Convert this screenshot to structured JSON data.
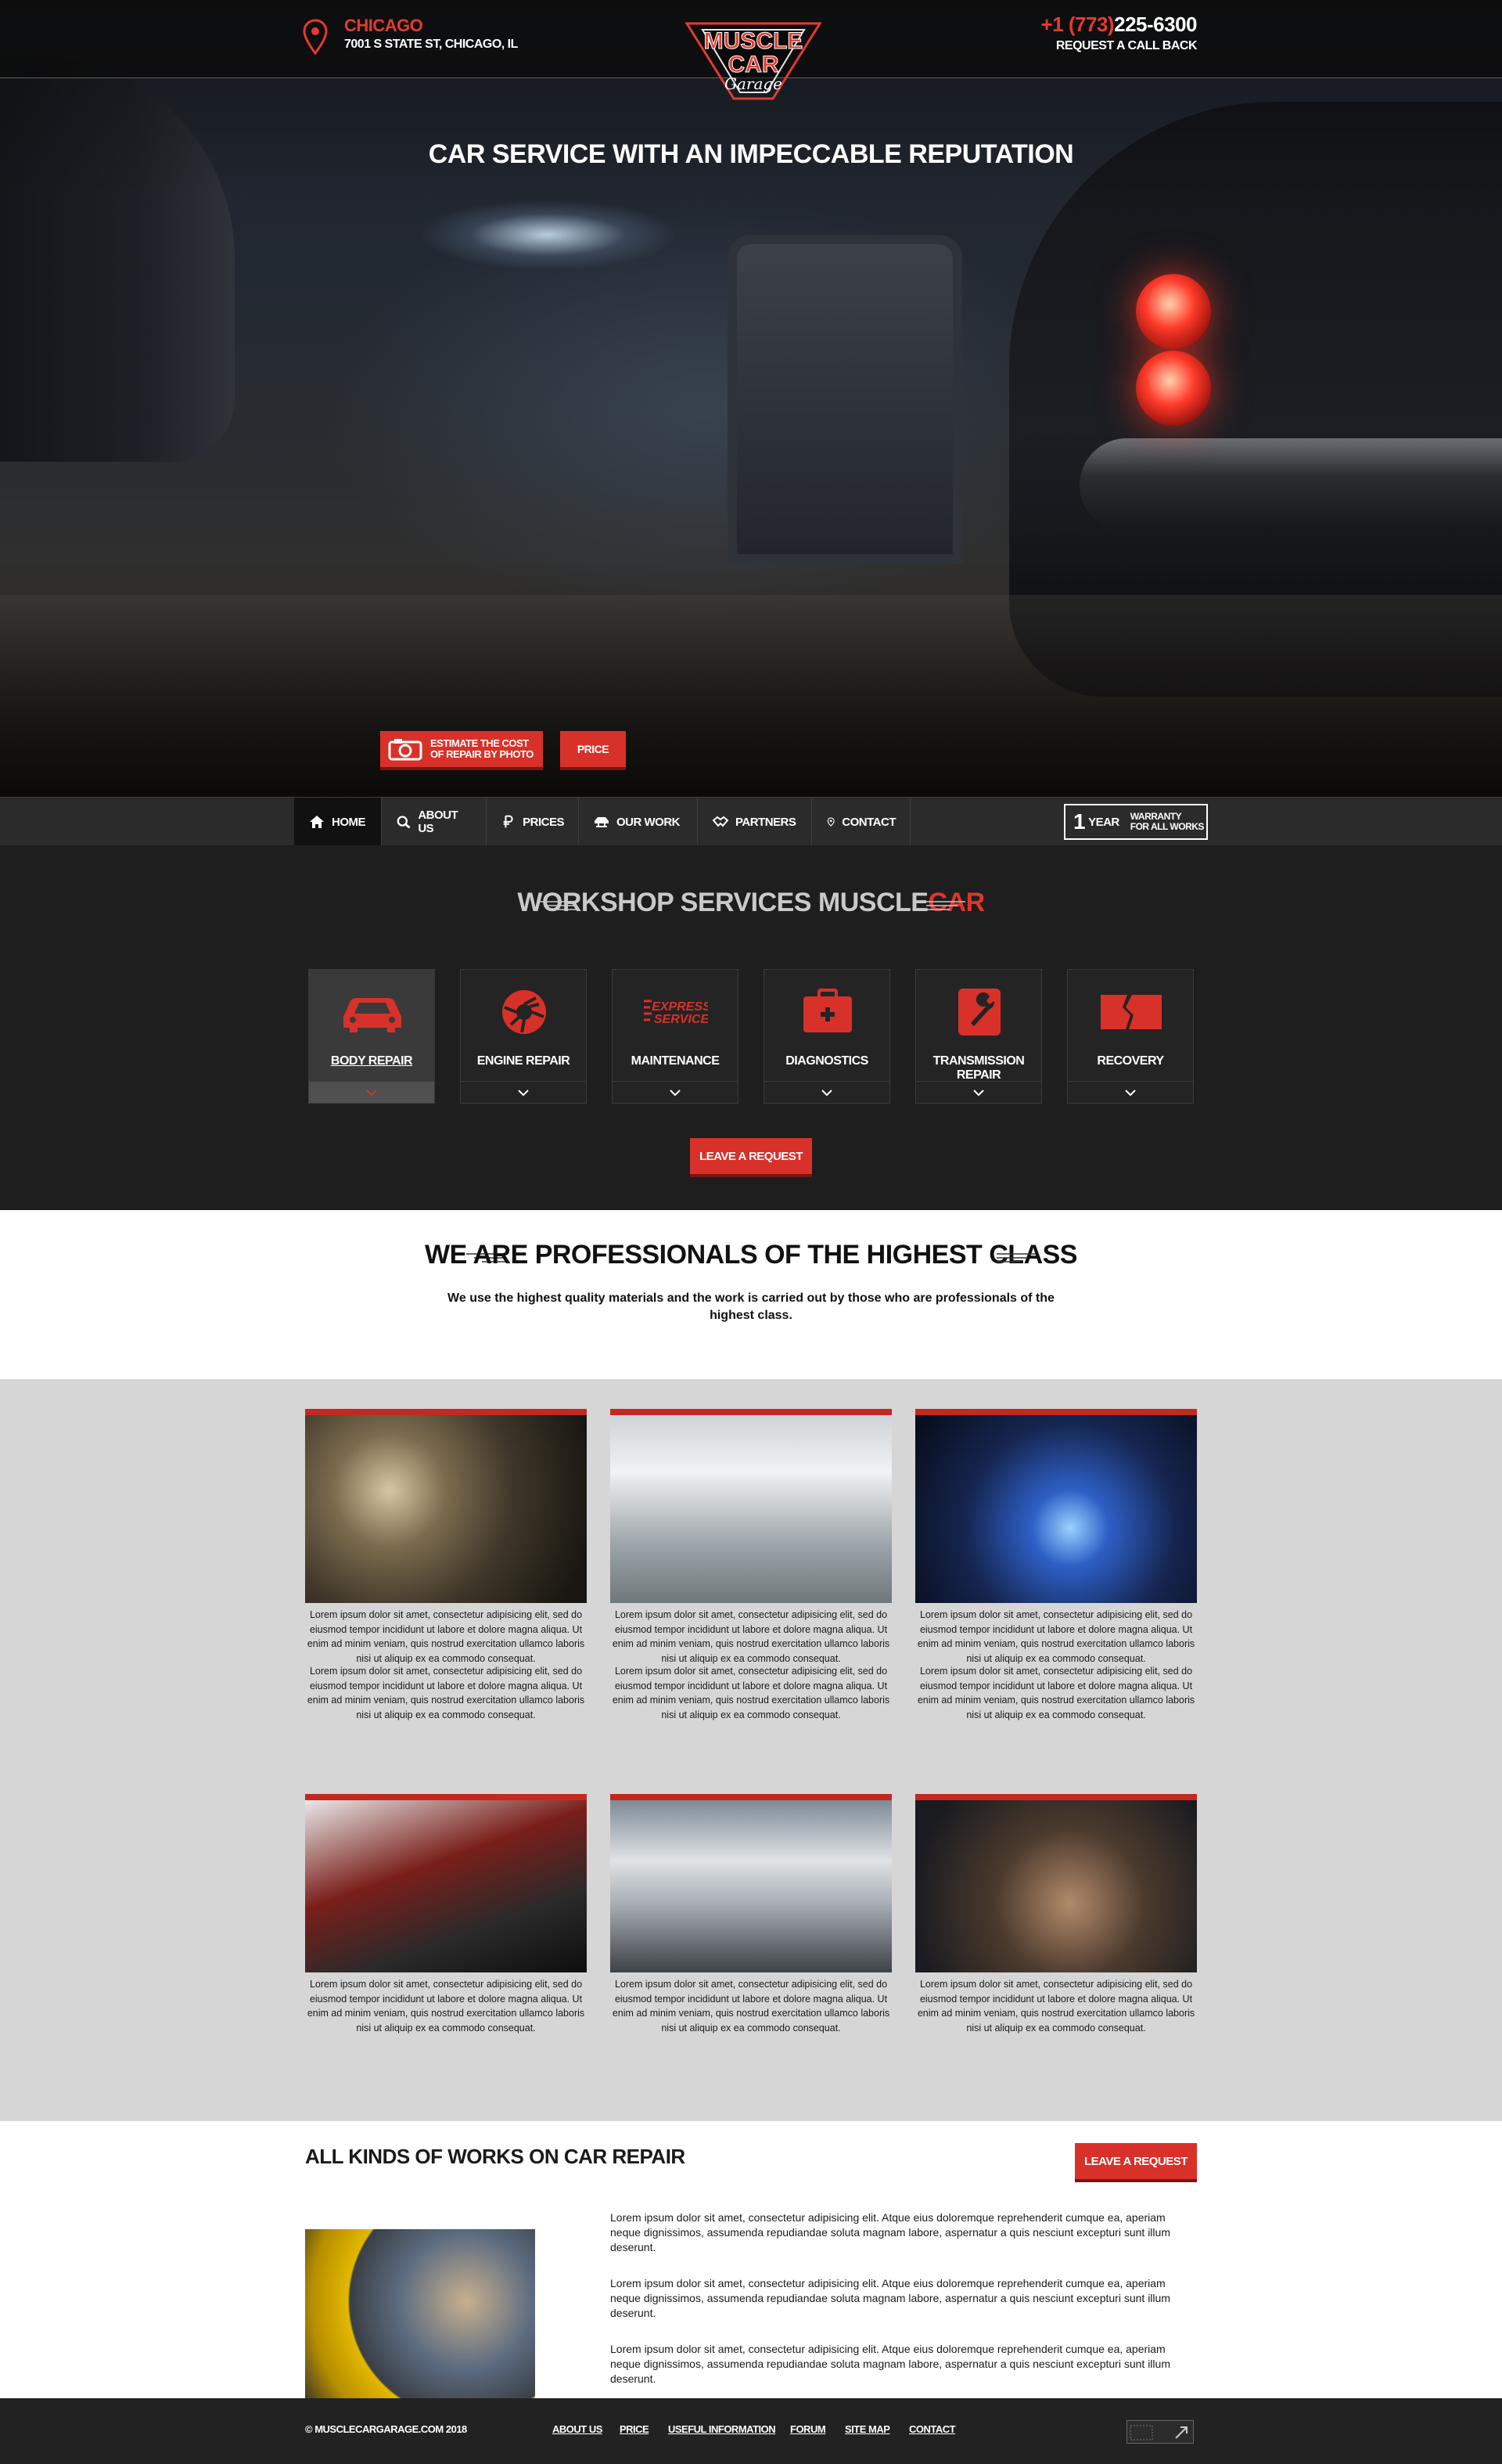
{
  "header": {
    "city": "CHICAGO",
    "address": "7001 S STATE ST, CHICAGO, IL",
    "logo": {
      "line1": "MUSCLE",
      "line2": "CAR",
      "line3": "Garage"
    },
    "phone_code": "+1 (773)",
    "phone_number": "225-6300",
    "callback_label": "REQUEST A CALL BACK"
  },
  "hero": {
    "title": "CAR SERVICE WITH AN IMPECCABLE REPUTATION",
    "photo_button_line1": "ESTIMATE THE COST",
    "photo_button_line2": "OF REPAIR BY PHOTO",
    "price_button": "PRICE"
  },
  "nav": {
    "items": [
      {
        "label": "HOME",
        "icon": "home-icon"
      },
      {
        "label": "ABOUT US",
        "icon": "search-icon"
      },
      {
        "label": "PRICES",
        "icon": "ruble-icon"
      },
      {
        "label": "OUR WORK",
        "icon": "car-lift-icon"
      },
      {
        "label": "PARTNERS",
        "icon": "handshake-icon"
      },
      {
        "label": "CONTACT",
        "icon": "location-pin-icon"
      }
    ],
    "warranty": {
      "number": "1",
      "unit": "YEAR",
      "line1": "WARRANTY",
      "line2": "FOR ALL WORKS"
    }
  },
  "services": {
    "title_part1": "WORKSHOP SERVICES MUSCLE",
    "title_part2": "CAR",
    "items": [
      {
        "label": "BODY REPAIR",
        "icon": "car-body-icon"
      },
      {
        "label": "ENGINE REPAIR",
        "icon": "gear-icon"
      },
      {
        "label": "MAINTENANCE",
        "icon": "express-service-icon",
        "icon_text1": "EXPRESS",
        "icon_text2": "SERVICE"
      },
      {
        "label": "DIAGNOSTICS",
        "icon": "toolbox-icon"
      },
      {
        "label": "TRANSMISSION REPAIR",
        "icon": "wrench-icon"
      },
      {
        "label": "RECOVERY",
        "icon": "broken-glass-icon"
      }
    ],
    "leave_request": "LEAVE A REQUEST"
  },
  "pro": {
    "title": "WE ARE PROFESSIONALS OF THE HIGHEST CLASS",
    "text": "We use the highest quality materials and the work is carried out by those who are professionals of the highest class."
  },
  "gallery": {
    "lorem": "Lorem ipsum dolor sit amet, consectetur adipisicing elit, sed do eiusmod tempor incididunt ut labore et dolore magna aliqua. Ut enim ad minim veniam, quis nostrud exercitation ullamco laboris nisi ut aliquip ex ea commodo consequat.",
    "cards": [
      {
        "image": "engine-valvetrain-photo"
      },
      {
        "image": "paint-booth-photo"
      },
      {
        "image": "welding-photo"
      },
      {
        "image": "oil-change-photo"
      },
      {
        "image": "mechanic-kneeling-photo"
      },
      {
        "image": "mechanic-under-car-photo"
      }
    ]
  },
  "works": {
    "title": "ALL KINDS OF WORKS ON CAR REPAIR",
    "leave_request": "LEAVE A REQUEST",
    "paragraph": "Lorem ipsum dolor sit amet, consectetur adipisicing elit. Atque eius doloremque reprehenderit cumque ea, aperiam neque dignissimos, assumenda repudiandae soluta magnam labore, aspernatur a quis nesciunt excepturi sunt illum deserunt."
  },
  "footer": {
    "copyright": "© MUSCLECARGARAGE.COM 2018",
    "links": [
      "ABOUT US",
      "PRICE",
      "USEFUL INFORMATION",
      "FORUM",
      "SITE MAP",
      "CONTACT"
    ]
  },
  "colors": {
    "accent": "#d8312a",
    "dark": "#1e1e1e",
    "nav": "#2b2b2b",
    "gallery_bg": "#d6d6d6"
  }
}
